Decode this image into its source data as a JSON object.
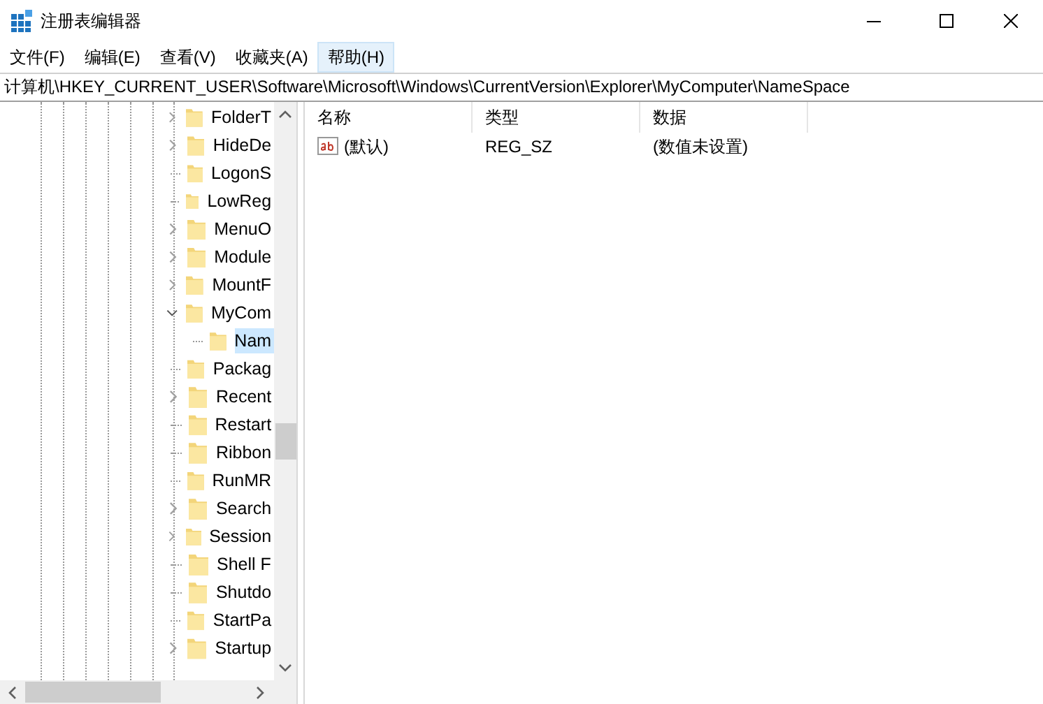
{
  "window": {
    "title": "注册表编辑器"
  },
  "menu": [
    {
      "label": "文件(F)",
      "selected": false
    },
    {
      "label": "编辑(E)",
      "selected": false
    },
    {
      "label": "查看(V)",
      "selected": false
    },
    {
      "label": "收藏夹(A)",
      "selected": false
    },
    {
      "label": "帮助(H)",
      "selected": true
    }
  ],
  "address": "计算机\\HKEY_CURRENT_USER\\Software\\Microsoft\\Windows\\CurrentVersion\\Explorer\\MyComputer\\NameSpace",
  "tree": [
    {
      "name": "FolderT",
      "kind": "collapsed",
      "selected": false
    },
    {
      "name": "HideDe",
      "kind": "collapsed",
      "selected": false
    },
    {
      "name": "LogonS",
      "kind": "leaf",
      "selected": false
    },
    {
      "name": "LowReg",
      "kind": "leaf",
      "selected": false
    },
    {
      "name": "MenuO",
      "kind": "collapsed",
      "selected": false
    },
    {
      "name": "Module",
      "kind": "collapsed",
      "selected": false
    },
    {
      "name": "MountF",
      "kind": "collapsed",
      "selected": false
    },
    {
      "name": "MyCom",
      "kind": "expanded",
      "selected": false,
      "children": [
        {
          "name": "Nam",
          "kind": "leaf",
          "selected": true
        }
      ]
    },
    {
      "name": "Packag",
      "kind": "leaf",
      "selected": false
    },
    {
      "name": "Recent",
      "kind": "collapsed",
      "selected": false
    },
    {
      "name": "Restart",
      "kind": "leaf",
      "selected": false
    },
    {
      "name": "Ribbon",
      "kind": "leaf",
      "selected": false
    },
    {
      "name": "RunMR",
      "kind": "leaf",
      "selected": false
    },
    {
      "name": "Search",
      "kind": "collapsed",
      "selected": false
    },
    {
      "name": "Session",
      "kind": "collapsed",
      "selected": false
    },
    {
      "name": "Shell F",
      "kind": "leaf",
      "selected": false
    },
    {
      "name": "Shutdo",
      "kind": "leaf",
      "selected": false
    },
    {
      "name": "StartPa",
      "kind": "leaf",
      "selected": false
    },
    {
      "name": "Startup",
      "kind": "collapsed",
      "selected": false
    }
  ],
  "values": {
    "columns": [
      "名称",
      "类型",
      "数据"
    ],
    "rows": [
      {
        "name": "(默认)",
        "type": "REG_SZ",
        "data": "(数值未设置)"
      }
    ]
  }
}
